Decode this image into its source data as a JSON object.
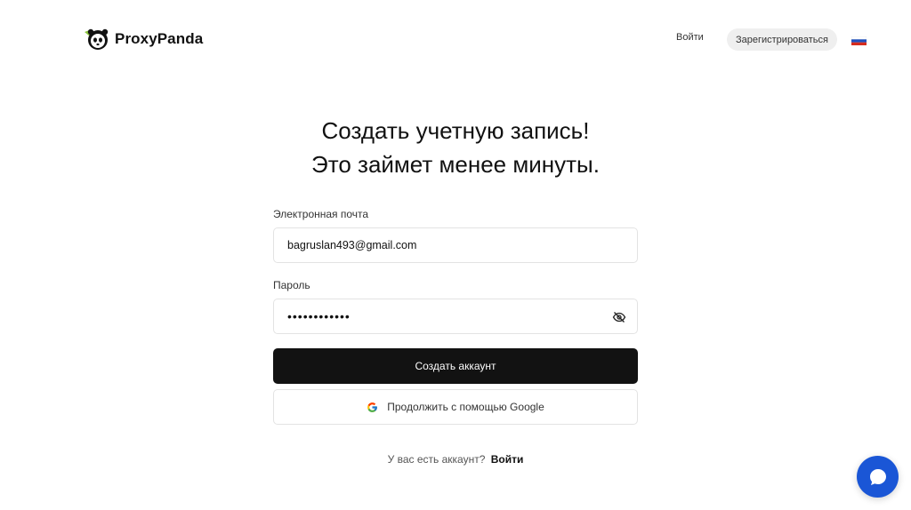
{
  "header": {
    "logo_text": "ProxyPanda",
    "login_label": "Войти",
    "register_label": "Зарегистрироваться",
    "language_icon": "russian-flag-icon"
  },
  "main": {
    "heading_line1": "Создать учетную запись!",
    "heading_line2": "Это займет менее минуты.",
    "email": {
      "label": "Электронная почта",
      "value": "bagruslan493@gmail.com"
    },
    "password": {
      "label": "Пароль",
      "value": "••••••••••••",
      "toggle_icon": "eye-off-icon"
    },
    "create_button": "Создать аккаунт",
    "google_button": "Продолжить с помощью Google",
    "have_account_text": "У вас есть аккаунт?",
    "login_link": "Войти"
  },
  "colors": {
    "primary_button": "#121212",
    "chat_bubble": "#1a56d6",
    "logo_leaf": "#8cc63f"
  }
}
